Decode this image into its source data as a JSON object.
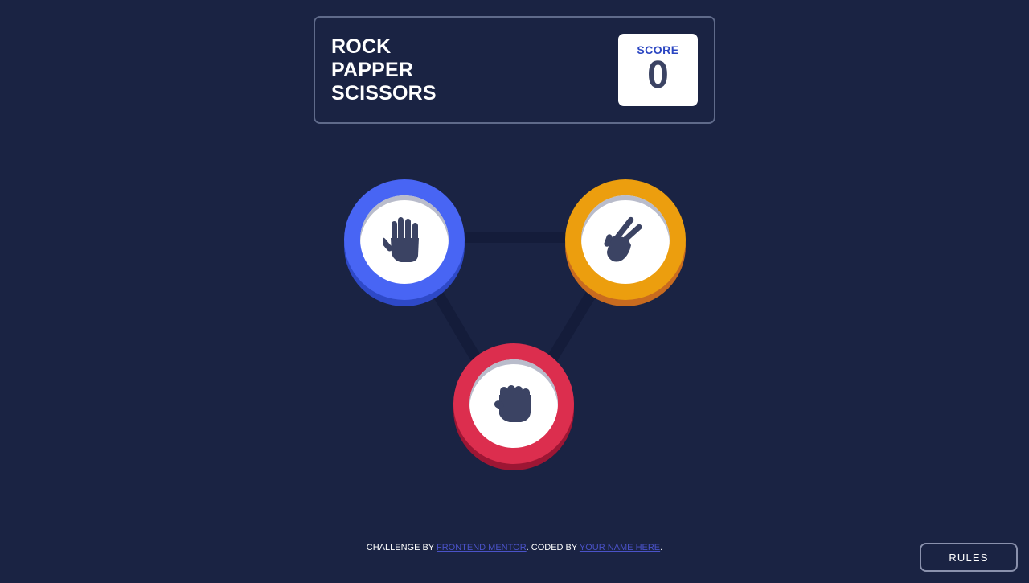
{
  "header": {
    "title_lines": [
      "ROCK",
      "PAPPER",
      "SCISSORS"
    ],
    "score_label": "SCORE",
    "score_value": "0"
  },
  "choices": [
    {
      "id": "paper",
      "icon": "paper-hand-icon",
      "color": "#4865f4"
    },
    {
      "id": "scissors",
      "icon": "scissors-hand-icon",
      "color": "#ec9e0e"
    },
    {
      "id": "rock",
      "icon": "rock-fist-icon",
      "color": "#dc2e4e"
    }
  ],
  "footer": {
    "prefix": "CHALLENGE BY ",
    "link1": "FRONTEND MENTOR",
    "middle": ". CODED BY ",
    "link2": "YOUR NAME HERE",
    "suffix": "."
  },
  "rules_button": {
    "label": "RULES"
  },
  "colors": {
    "background": "#1a2343",
    "header_border": "#5f6a8a",
    "score_label": "#2b46c2",
    "score_value": "#3b4363"
  }
}
